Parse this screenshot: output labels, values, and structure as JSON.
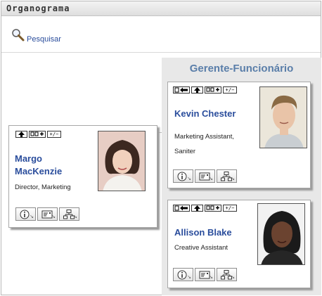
{
  "app": {
    "title": "Organograma"
  },
  "toolbar": {
    "search_label": "Pesquisar",
    "search_icon": "magnifier-icon"
  },
  "panel": {
    "title": "Gerente-Funcionário"
  },
  "nav_buttons": [
    {
      "name": "move-to-manager-button",
      "icon": "arrow-left-person-icon"
    },
    {
      "name": "move-up-button",
      "icon": "arrow-up-icon"
    },
    {
      "name": "view-group-button",
      "icon": "group-plus-icon"
    },
    {
      "name": "expand-collapse-button",
      "label": "+/−"
    }
  ],
  "action_buttons": [
    {
      "name": "info-button",
      "icon": "info-icon"
    },
    {
      "name": "email-button",
      "icon": "email-icon"
    },
    {
      "name": "org-chart-button",
      "icon": "org-chart-icon"
    }
  ],
  "people": [
    {
      "name_line1": "Margo",
      "name_line2": "MacKenzie",
      "title": "Director, Marketing"
    },
    {
      "name_line1": "Kevin Chester",
      "title_line1": "Marketing Assistant,",
      "title_line2": "Saniter"
    },
    {
      "name_line1": "Allison Blake",
      "title": "Creative Assistant"
    }
  ],
  "colors": {
    "link_blue": "#2a4d9c",
    "panel_title": "#5a7ea9",
    "panel_bg": "#e8e8e8"
  }
}
